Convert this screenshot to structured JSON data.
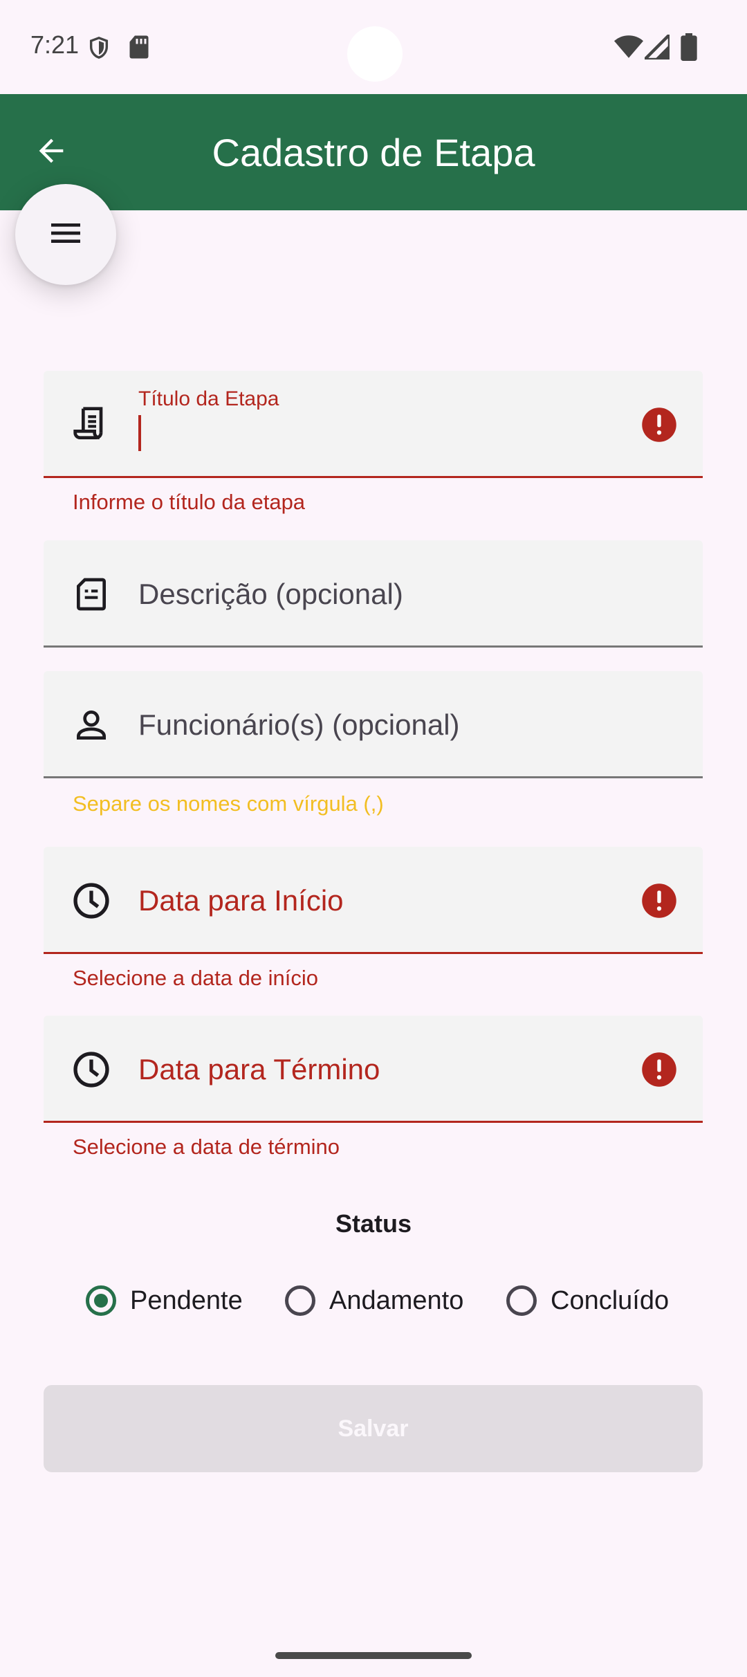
{
  "status_bar": {
    "time": "7:21",
    "icons": [
      "shield-icon",
      "sd-card-icon",
      "wifi-icon",
      "signal-icon",
      "battery-icon"
    ]
  },
  "app_bar": {
    "title": "Cadastro de Etapa",
    "back_icon": "arrow-back-icon",
    "menu_icon": "menu-icon"
  },
  "form": {
    "titulo": {
      "label": "Título da Etapa",
      "value": "",
      "icon": "receipt-icon",
      "error": "Informe o título da etapa"
    },
    "descricao": {
      "label": "Descrição (opcional)",
      "icon": "description-icon"
    },
    "funcionarios": {
      "label": "Funcionário(s) (opcional)",
      "icon": "person-icon",
      "helper": "Separe os nomes com vírgula (,)"
    },
    "data_inicio": {
      "label": "Data para Início",
      "icon": "clock-icon",
      "error": "Selecione a data de início"
    },
    "data_termino": {
      "label": "Data para Término",
      "icon": "clock-icon",
      "error": "Selecione a data de término"
    },
    "status": {
      "title": "Status",
      "options": [
        {
          "label": "Pendente",
          "selected": true
        },
        {
          "label": "Andamento",
          "selected": false
        },
        {
          "label": "Concluído",
          "selected": false
        }
      ]
    },
    "save_label": "Salvar"
  },
  "colors": {
    "primary": "#26704a",
    "error": "#b3261e",
    "warning": "#f2be22",
    "background": "#fcf4fb"
  }
}
